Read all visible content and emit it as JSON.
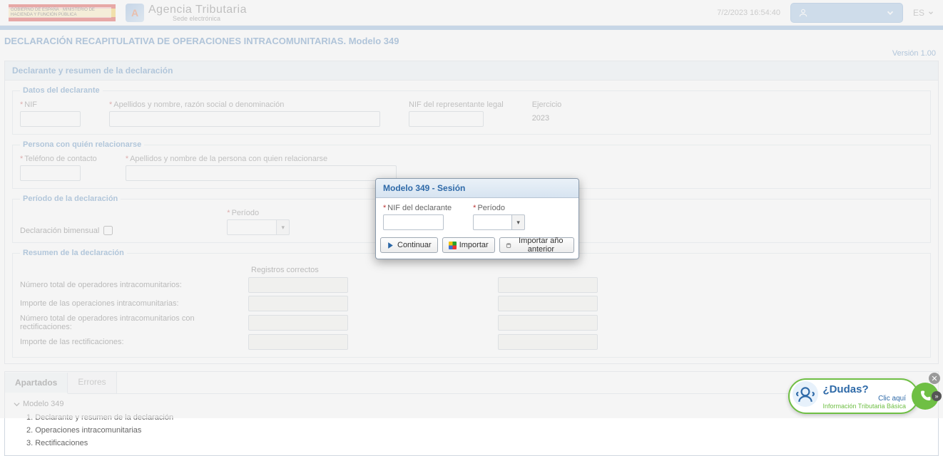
{
  "header": {
    "gob_text": "Gobierno de España · Ministerio de Hacienda y Función Pública",
    "agency": "Agencia Tributaria",
    "agency_sub": "Sede electrónica",
    "timestamp": "7/2/2023 16:54:40",
    "lang": "ES"
  },
  "page": {
    "title": "DECLARACIÓN RECAPITULATIVA DE OPERACIONES INTRACOMUNITARIAS. Modelo 349",
    "version": "Versión 1.00"
  },
  "panel": {
    "heading": "Declarante y resumen de la declaración",
    "grp_declarante": {
      "legend": "Datos del declarante",
      "nif_label": "NIF",
      "name_label": "Apellidos y nombre, razón social o denominación",
      "rep_label": "NIF del representante legal",
      "ejercicio_label": "Ejercicio",
      "ejercicio_value": "2023"
    },
    "grp_persona": {
      "legend": "Persona con quién relacionarse",
      "tel_label": "Teléfono de contacto",
      "nom_label": "Apellidos y nombre de la persona con quien relacionarse"
    },
    "grp_periodo": {
      "legend": "Período de la declaración",
      "bimensual_label": "Declaración bimensual",
      "periodo_label": "Período"
    },
    "grp_resumen": {
      "legend": "Resumen de la declaración",
      "col_correctos": "Registros correctos",
      "rows": [
        "Número total de operadores intracomunitarios:",
        "Importe de las operaciones intracomunitarias:",
        "Número total de operadores intracomunitarios con rectificaciones:",
        "Importe de las rectificaciones:"
      ]
    }
  },
  "tabs": {
    "apartados": "Apartados",
    "errores": "Errores",
    "root": "Modelo 349",
    "items": [
      "1. Declarante y resumen de la declaración",
      "2. Operaciones intracomunitarias",
      "3. Rectificaciones"
    ]
  },
  "modal": {
    "title": "Modelo 349 - Sesión",
    "nif_label": "NIF del declarante",
    "periodo_label": "Período",
    "btn_continuar": "Continuar",
    "btn_importar": "Importar",
    "btn_importar_ano": "Importar año anterior"
  },
  "help": {
    "q": "¿Dudas?",
    "c": "Clic aquí",
    "s": "Información Tributaria Básica"
  }
}
